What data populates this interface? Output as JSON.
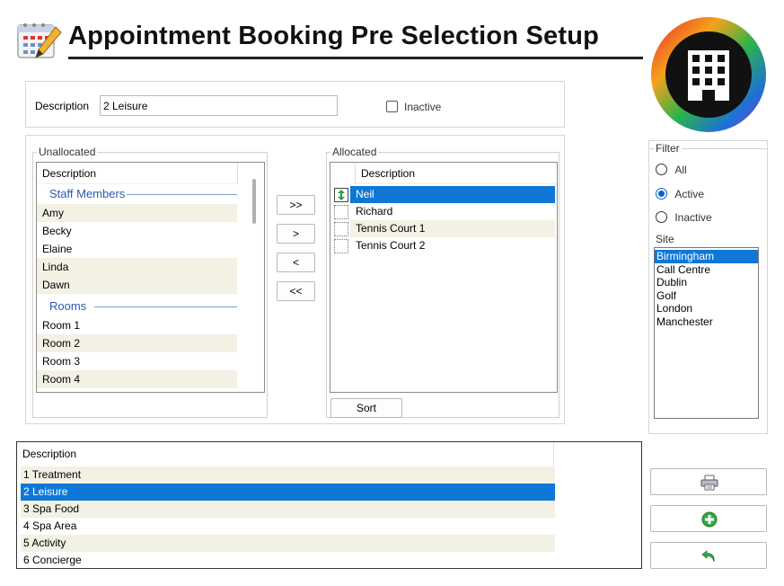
{
  "header": {
    "title": "Appointment Booking Pre Selection Setup"
  },
  "description_field": {
    "label": "Description",
    "value": "2 Leisure"
  },
  "inactive_checkbox": {
    "label": "Inactive",
    "checked": false
  },
  "unallocated": {
    "legend": "Unallocated",
    "column": "Description",
    "groups": [
      {
        "title": "Staff Members",
        "items": [
          "Amy",
          "Becky",
          "Elaine",
          "Linda",
          "Dawn"
        ]
      },
      {
        "title": "Rooms",
        "items": [
          "Room 1",
          "Room 2",
          "Room 3",
          "Room 4"
        ]
      }
    ]
  },
  "transfer_buttons": {
    "add_all": ">>",
    "add": ">",
    "remove": "<",
    "remove_all": "<<"
  },
  "allocated": {
    "legend": "Allocated",
    "column": "Description",
    "items": [
      "Neil",
      "Richard",
      "Tennis Court 1",
      "Tennis Court 2"
    ],
    "selected_index": 0,
    "sort_label": "Sort"
  },
  "filter": {
    "legend": "Filter",
    "options": [
      "All",
      "Active",
      "Inactive"
    ],
    "selected": "Active",
    "site_label": "Site",
    "sites": [
      "Birmingham",
      "Call Centre",
      "Dublin",
      "Golf",
      "London",
      "Manchester"
    ],
    "selected_site": "Birmingham"
  },
  "bottom_list": {
    "column": "Description",
    "items": [
      "1 Treatment",
      "2 Leisure",
      "3 Spa Food",
      "4 Spa Area",
      "5 Activity",
      "6 Concierge"
    ],
    "selected_index": 1
  },
  "actions": {
    "print_icon": "printer-icon",
    "add_icon": "plus-circle-icon",
    "undo_icon": "undo-arrow-icon"
  },
  "colors": {
    "selection": "#0f78d7",
    "alt_row": "#f3f1e3",
    "group_header": "#2a5ab0"
  }
}
